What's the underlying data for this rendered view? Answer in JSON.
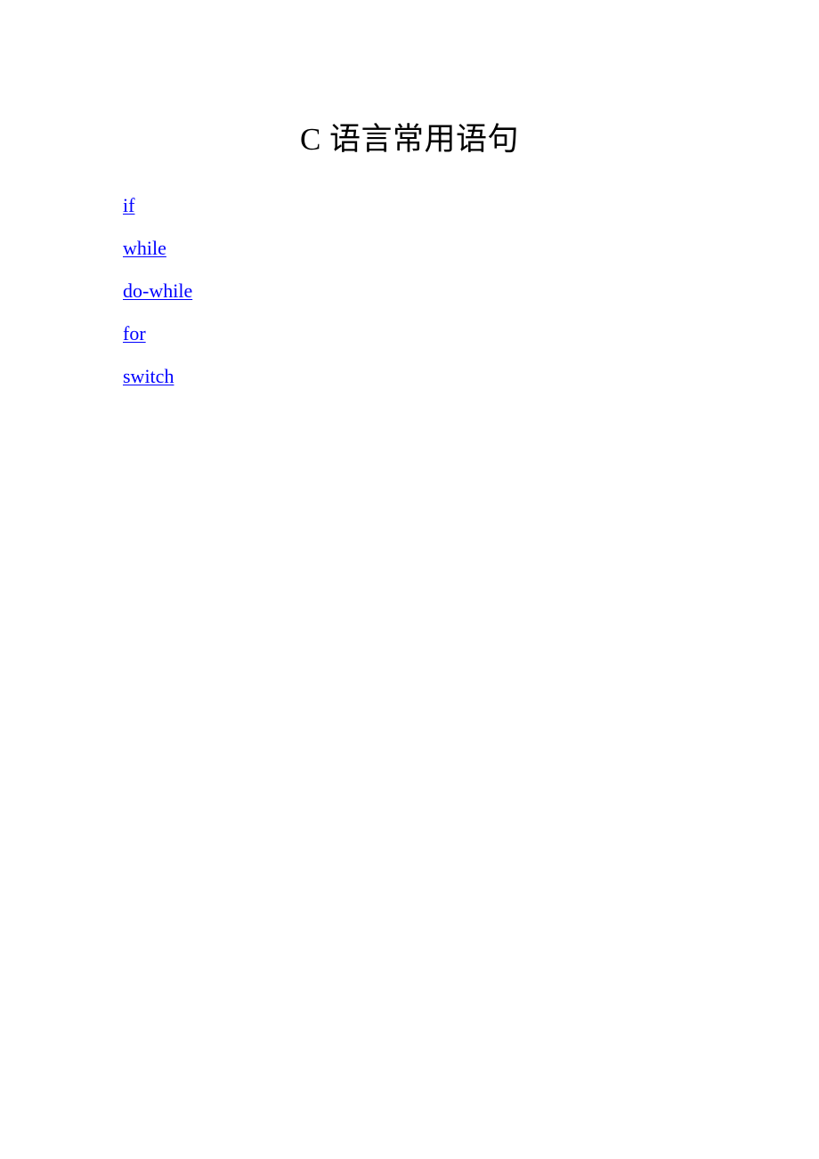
{
  "document": {
    "title": "C 语言常用语句",
    "background_color": "#ffffff",
    "text_color": "#000000",
    "link_color": "#0000ff"
  },
  "links": [
    {
      "label": "if"
    },
    {
      "label": "while"
    },
    {
      "label": "do-while"
    },
    {
      "label": "for"
    },
    {
      "label": "switch"
    }
  ]
}
